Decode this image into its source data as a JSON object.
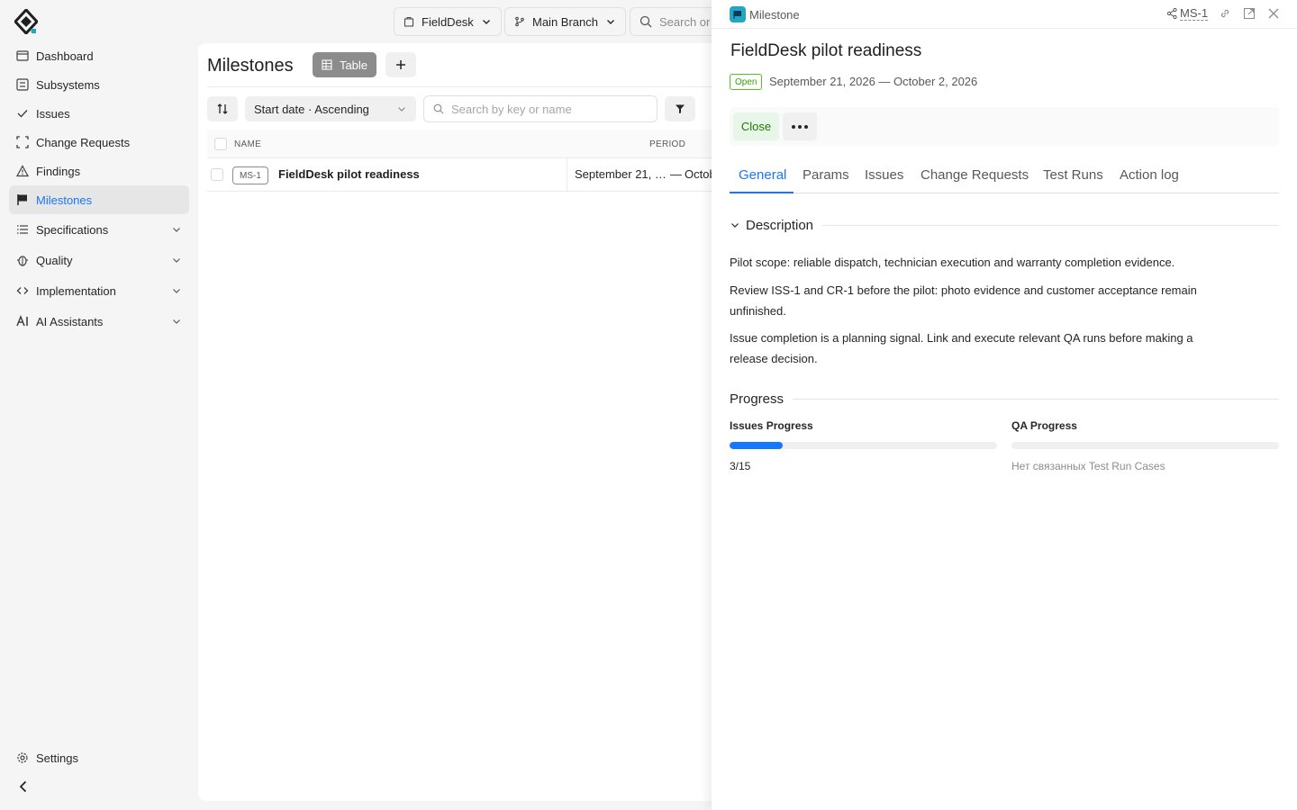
{
  "sidebar": {
    "items": [
      {
        "label": "Dashboard"
      },
      {
        "label": "Subsystems"
      },
      {
        "label": "Issues"
      },
      {
        "label": "Change Requests"
      },
      {
        "label": "Findings"
      },
      {
        "label": "Milestones",
        "active": true
      },
      {
        "label": "Specifications",
        "expandable": true
      },
      {
        "label": "Quality",
        "expandable": true
      },
      {
        "label": "Implementation",
        "expandable": true
      },
      {
        "label": "AI Assistants",
        "expandable": true
      }
    ],
    "settings_label": "Settings"
  },
  "topbar": {
    "project": "FieldDesk",
    "branch": "Main Branch",
    "search_placeholder": "Search or"
  },
  "main": {
    "title": "Milestones",
    "view_label": "Table",
    "sort_label": "Start date · Ascending",
    "search_placeholder": "Search by key or name",
    "columns": {
      "name": "NAME",
      "period": "PERIOD"
    },
    "rows": [
      {
        "key": "MS-1",
        "name": "FieldDesk pilot readiness",
        "start": "September 21, …",
        "dash": "—",
        "end": "Octob"
      }
    ]
  },
  "drawer": {
    "type_label": "Milestone",
    "key": "MS-1",
    "title": "FieldDesk pilot readiness",
    "status": "Open",
    "period": "September 21, 2026 — October 2, 2026",
    "close_label": "Close",
    "tabs": [
      "General",
      "Params",
      "Issues",
      "Change Requests",
      "Test Runs",
      "Action log"
    ],
    "active_tab": "General",
    "description_header": "Description",
    "description": [
      "Pilot scope: reliable dispatch, technician execution and warranty completion evidence.",
      "Review ISS-1 and CR-1 before the pilot: photo evidence and customer acceptance remain unfinished.",
      "Issue completion is a planning signal. Link and execute relevant QA runs before making a release decision."
    ],
    "progress_header": "Progress",
    "issues_progress": {
      "title": "Issues Progress",
      "value_text": "3/15",
      "fraction": 0.2
    },
    "qa_progress": {
      "title": "QA Progress",
      "value_text": "Нет связанных Test Run Cases",
      "fraction": 0
    }
  },
  "colors": {
    "accent": "#1677ff",
    "status_open": "#389e0d",
    "milestone_icon": "#22a6c3"
  }
}
